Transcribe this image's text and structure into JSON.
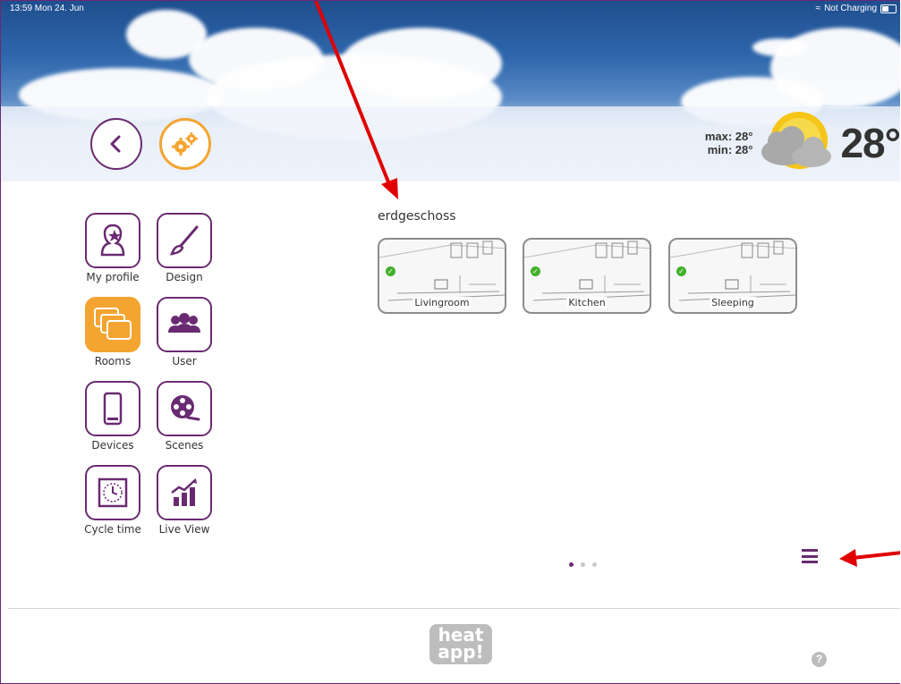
{
  "status_bar": {
    "time_date": "13:59  Mon 24. Jun",
    "charging": "Not Charging"
  },
  "weather": {
    "max": "max: 28°",
    "min": "min: 28°",
    "temperature": "28°"
  },
  "menu": {
    "items": [
      {
        "label": "My profile",
        "icon": "profile-star-icon"
      },
      {
        "label": "Design",
        "icon": "brush-icon"
      },
      {
        "label": "Rooms",
        "icon": "rooms-icon",
        "active": true
      },
      {
        "label": "User",
        "icon": "users-icon"
      },
      {
        "label": "Devices",
        "icon": "phone-icon"
      },
      {
        "label": "Scenes",
        "icon": "film-reel-icon"
      },
      {
        "label": "Cycle time",
        "icon": "clock-icon"
      },
      {
        "label": "Live View",
        "icon": "chart-icon"
      }
    ]
  },
  "main": {
    "floor": "erdgeschoss",
    "rooms": [
      {
        "label": "Livingroom",
        "status": "ok"
      },
      {
        "label": "Kitchen",
        "status": "ok"
      },
      {
        "label": "Sleeping",
        "status": "ok"
      }
    ],
    "pagination": {
      "pages": 3,
      "current": 1
    }
  },
  "footer": {
    "logo_text": "heat app!",
    "help": "?"
  },
  "colors": {
    "accent_purple": "#6a2a72",
    "accent_orange": "#f4a430",
    "annotation_red": "#e00000"
  }
}
